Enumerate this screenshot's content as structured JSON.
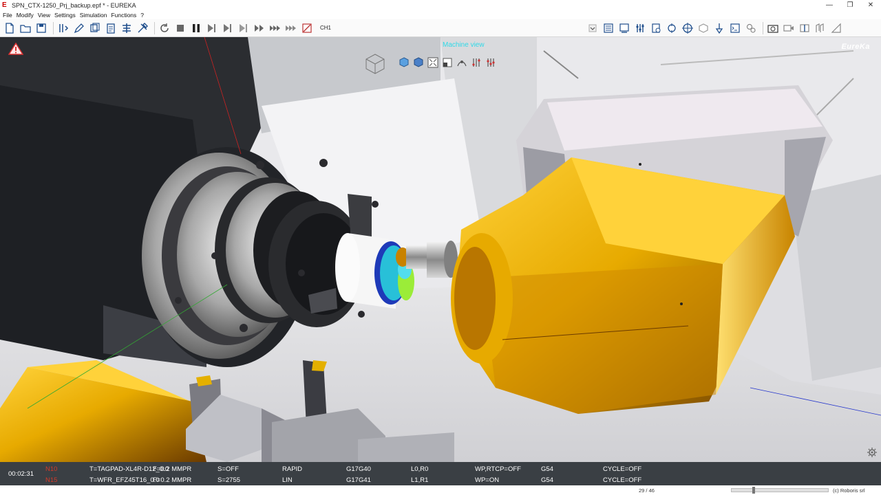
{
  "window": {
    "title": "SPN_CTX-1250_Prj_backup.epf * - EUREKA",
    "controls": [
      "—",
      "❐",
      "✕"
    ]
  },
  "menu": [
    "File",
    "Modify",
    "View",
    "Settings",
    "Simulation",
    "Functions",
    "?"
  ],
  "toolbar": {
    "channel": "CH1"
  },
  "viewport": {
    "view_label": "Machine view",
    "brand": "EureKa"
  },
  "status": {
    "time": "00:02:31",
    "rows": [
      {
        "line": "N10",
        "tool": "T=TAGPAD-XL4R-D12_0.0",
        "feed": "F=0.2 MMPR",
        "spindle": "S=OFF",
        "move": "RAPID",
        "gcode": "G17G40",
        "lr": "L0,R0",
        "wp": "WP,RTCP=OFF",
        "offset": "G54",
        "cycle": "CYCLE=OFF"
      },
      {
        "line": "N15",
        "tool": "T=WFR_EFZ45T16_0.0",
        "feed": "F=0.2 MMPR",
        "spindle": "S=2755",
        "move": "LIN",
        "gcode": "G17G41",
        "lr": "L1,R1",
        "wp": "WP=ON",
        "offset": "G54",
        "cycle": "CYCLE=OFF"
      }
    ]
  },
  "footer": {
    "page": "29 / 46",
    "slider_position": 0.22,
    "copyright": "(c) Roboris srl"
  },
  "colors": {
    "head_yellow": "#e7aa00",
    "status_bg": "#3a3f44",
    "view_label": "#30d9e8",
    "line_number": "#d23a2a"
  }
}
